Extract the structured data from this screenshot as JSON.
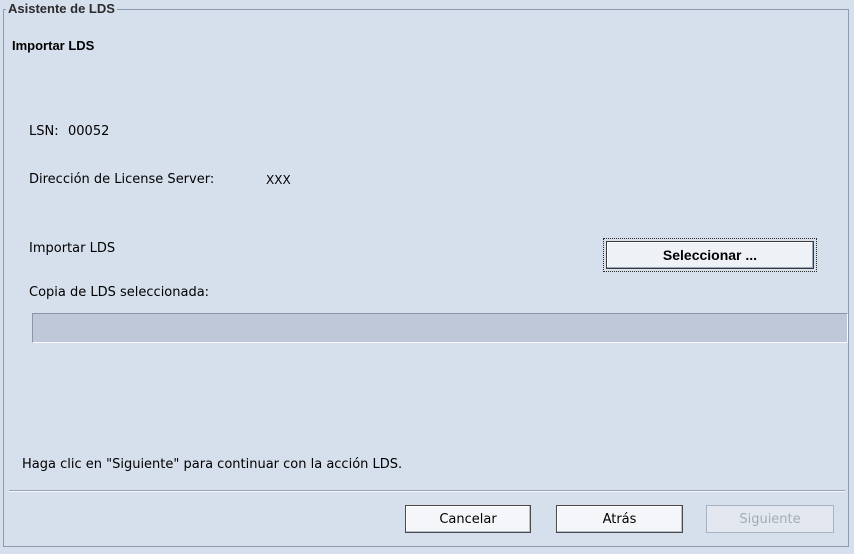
{
  "wizard": {
    "group_title": "Asistente de LDS",
    "step_title": "Importar LDS"
  },
  "info": {
    "lsn_label": "LSN:",
    "lsn_value": "00052",
    "server_label": "Dirección de License Server:",
    "server_value": "XXX"
  },
  "import": {
    "label": "Importar LDS",
    "select_button_label": "Seleccionar ...",
    "selected_copy_label": "Copia de LDS seleccionada:",
    "selected_copy_value": ""
  },
  "instructions": "Haga clic en \"Siguiente\" para continuar con la acción LDS.",
  "footer": {
    "cancel_label": "Cancelar",
    "back_label": "Atrás",
    "next_label": "Siguiente",
    "next_enabled": false
  }
}
